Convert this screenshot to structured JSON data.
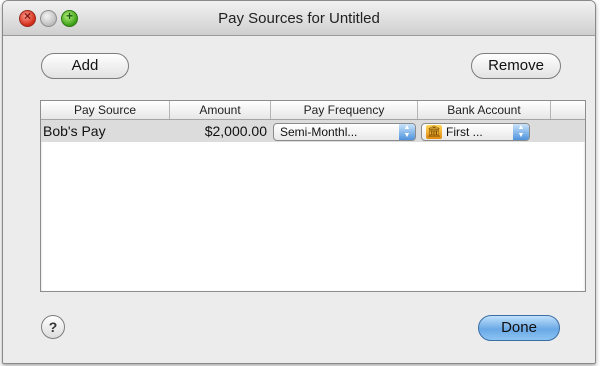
{
  "window": {
    "title": "Pay Sources for Untitled"
  },
  "buttons": {
    "add": "Add",
    "remove": "Remove",
    "done": "Done",
    "help": "?"
  },
  "table": {
    "columns": [
      "Pay Source",
      "Amount",
      "Pay Frequency",
      "Bank Account"
    ],
    "rows": [
      {
        "pay_source": "Bob's Pay",
        "amount": "$2,000.00",
        "frequency": "Semi-Monthl...",
        "bank": "First ..."
      }
    ]
  },
  "icons": {
    "bank": "bank-icon"
  },
  "colors": {
    "done_button": "#6aa9e6",
    "row_selected": "#dcdcdc"
  }
}
